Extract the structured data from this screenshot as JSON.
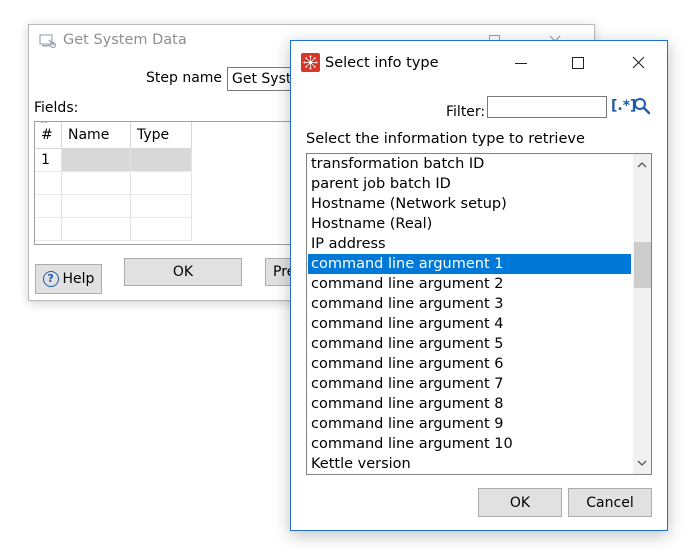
{
  "background_window": {
    "title": "Get System Data",
    "step_name_label": "Step name",
    "step_name_value": "Get System Data",
    "fields_label": "Fields:",
    "table": {
      "columns": [
        "#",
        "Name",
        "Type"
      ],
      "rows": [
        [
          "1",
          "",
          ""
        ],
        [
          "",
          "",
          ""
        ],
        [
          "",
          "",
          ""
        ],
        [
          "",
          "",
          ""
        ]
      ]
    },
    "help_label": "Help",
    "ok_label": "OK",
    "preview_label": "Preview"
  },
  "dialog": {
    "title": "Select info type",
    "filter_label": "Filter:",
    "filter_value": "",
    "regex_icon_text": "[.*]",
    "list_label": "Select the information type to retrieve",
    "items": [
      "transformation batch ID",
      "parent job batch ID",
      "Hostname (Network setup)",
      "Hostname (Real)",
      "IP address",
      "command line argument 1",
      "command line argument 2",
      "command line argument 3",
      "command line argument 4",
      "command line argument 5",
      "command line argument 6",
      "command line argument 7",
      "command line argument 8",
      "command line argument 9",
      "command line argument 10",
      "Kettle version"
    ],
    "selected_index": 5,
    "ok_label": "OK",
    "cancel_label": "Cancel"
  },
  "colors": {
    "selection": "#0078d7",
    "accent_border": "#1d6fd4",
    "app_icon": "#d9362a"
  }
}
